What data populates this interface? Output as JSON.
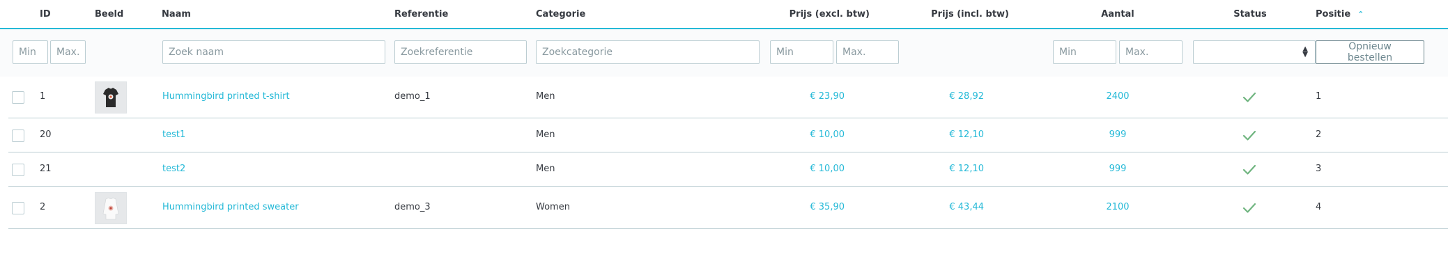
{
  "headers": {
    "id": "ID",
    "image": "Beeld",
    "name": "Naam",
    "reference": "Referentie",
    "category": "Categorie",
    "price_excl": "Prijs (excl. btw)",
    "price_incl": "Prijs (incl. btw)",
    "quantity": "Aantal",
    "status": "Status",
    "position": "Positie"
  },
  "filters": {
    "id_min": "Min",
    "id_max": "Max.",
    "name": "Zoek naam",
    "reference": "Zoekreferentie",
    "category": "Zoekcategorie",
    "price_min": "Min",
    "price_max": "Max.",
    "qty_min": "Min",
    "qty_max": "Max.",
    "reset_label": "Opnieuw bestellen"
  },
  "icons": {
    "sort_asc": "chevron-up-icon",
    "status_enabled": "checkmark-icon"
  },
  "colors": {
    "accent": "#25b9d7",
    "success": "#70b580",
    "text": "#363a41"
  },
  "products": [
    {
      "id": "1",
      "name": "Hummingbird printed t-shirt",
      "reference": "demo_1",
      "category": "Men",
      "price_excl": "€ 23,90",
      "price_incl": "€ 28,92",
      "quantity": "2400",
      "position": "1",
      "image": "tshirt"
    },
    {
      "id": "20",
      "name": "test1",
      "reference": "",
      "category": "Men",
      "price_excl": "€ 10,00",
      "price_incl": "€ 12,10",
      "quantity": "999",
      "position": "2",
      "image": ""
    },
    {
      "id": "21",
      "name": "test2",
      "reference": "",
      "category": "Men",
      "price_excl": "€ 10,00",
      "price_incl": "€ 12,10",
      "quantity": "999",
      "position": "3",
      "image": ""
    },
    {
      "id": "2",
      "name": "Hummingbird printed sweater",
      "reference": "demo_3",
      "category": "Women",
      "price_excl": "€ 35,90",
      "price_incl": "€ 43,44",
      "quantity": "2100",
      "position": "4",
      "image": "sweater"
    }
  ]
}
